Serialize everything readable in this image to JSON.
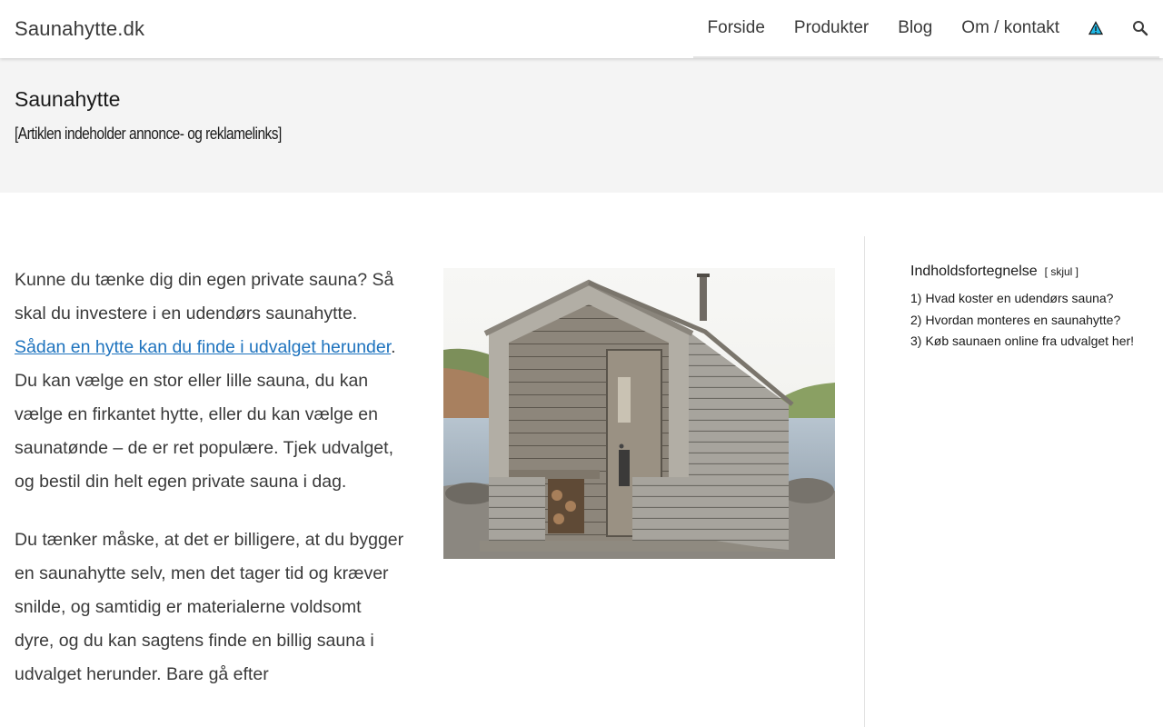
{
  "header": {
    "site_title": "Saunahytte.dk",
    "nav": [
      "Forside",
      "Produkter",
      "Blog",
      "Om / kontakt"
    ],
    "icons": [
      "warning-icon",
      "search-icon"
    ]
  },
  "hero": {
    "title": "Saunahytte",
    "disclaimer": "[Artiklen indeholder annonce- og reklamelinks]"
  },
  "article": {
    "p1_a": "Kunne du tænke dig din egen private sauna? Så skal du investere i en udendørs saunahytte. ",
    "p1_link": "Sådan en hytte kan du finde i udvalget herunder",
    "p1_b": ". Du kan vælge en stor eller lille sauna, du kan vælge en firkantet hytte, eller du kan vælge en saunatønde – de er ret populære. Tjek udvalget, og bestil din helt egen private sauna i dag.",
    "p2": "Du tænker måske, at det er billigere, at du bygger en saunahytte selv, men det tager tid og kræver snilde, og samtidig er materialerne voldsomt dyre, og du kan sagtens finde en billig sauna i udvalget herunder. Bare gå efter"
  },
  "toc": {
    "title": "Indholdsfortegnelse",
    "toggle": "[ skjul ]",
    "items": [
      {
        "num": "1)",
        "label": "Hvad koster en udendørs sauna?"
      },
      {
        "num": "2)",
        "label": "Hvordan monteres en saunahytte?"
      },
      {
        "num": "3)",
        "label": "Køb saunaen online fra udvalget her!"
      }
    ]
  },
  "colors": {
    "link": "#1e73be",
    "hero_bg": "#f4f4f4",
    "text": "#3a3a3a"
  }
}
